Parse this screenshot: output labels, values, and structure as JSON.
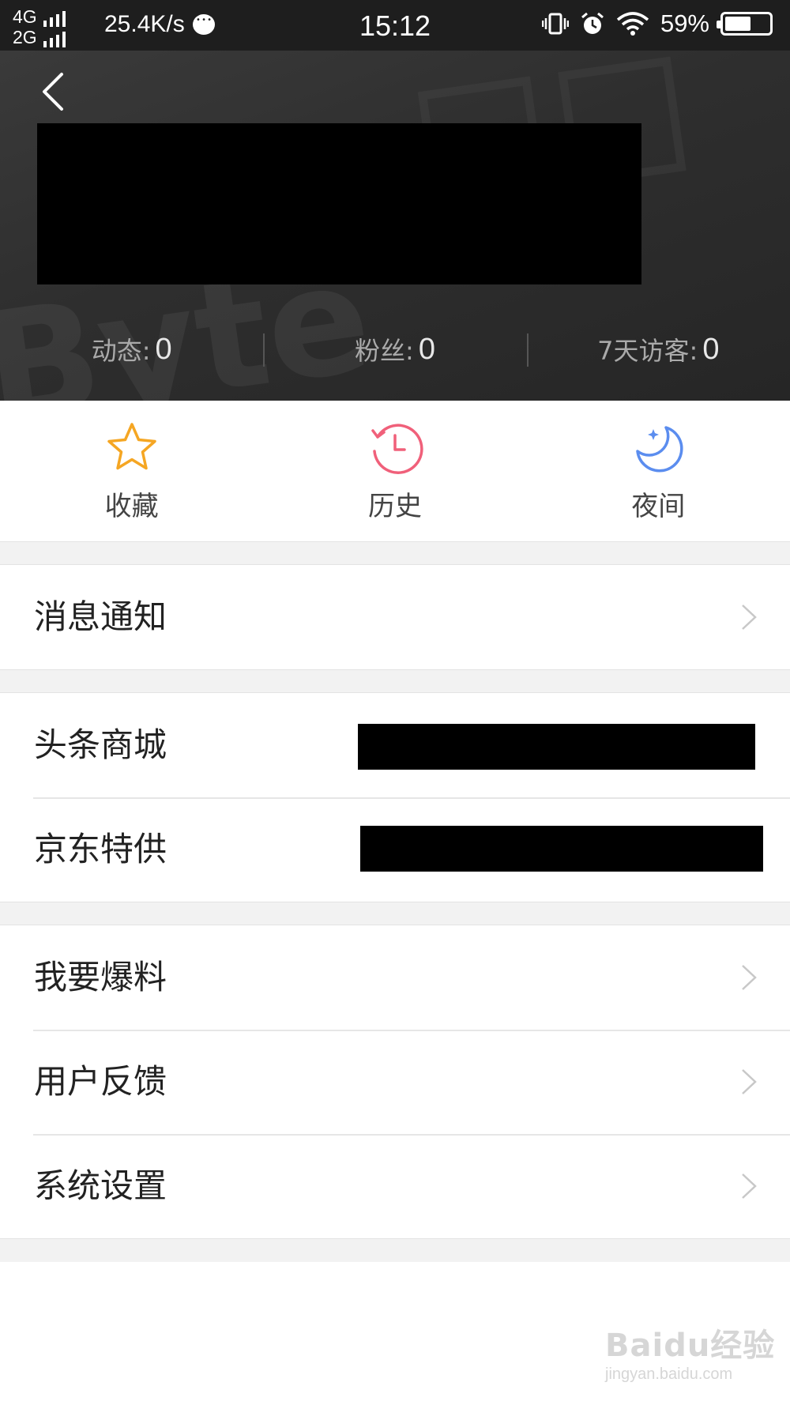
{
  "status_bar": {
    "network_1": "4G",
    "network_2": "2G",
    "speed": "25.4K/s",
    "time": "15:12",
    "battery": "59%",
    "battery_level": 0.59,
    "icons": [
      "signal-icon",
      "chat-icon",
      "vibrate-icon",
      "alarm-icon",
      "wifi-icon",
      "battery-icon"
    ]
  },
  "header": {
    "stats": [
      {
        "label": "动态:",
        "value": "0"
      },
      {
        "label": "粉丝:",
        "value": "0"
      },
      {
        "label": "7天访客:",
        "value": "0"
      }
    ]
  },
  "quick_actions": [
    {
      "label": "收藏",
      "icon": "star-icon",
      "color": "#f5a623"
    },
    {
      "label": "历史",
      "icon": "clock-history-icon",
      "color": "#f0607a"
    },
    {
      "label": "夜间",
      "icon": "moon-icon",
      "color": "#5b8def"
    }
  ],
  "menu": {
    "message": "消息通知",
    "mall": "头条商城",
    "jd": "京东特供",
    "report": "我要爆料",
    "feedback": "用户反馈",
    "settings": "系统设置"
  },
  "watermark": {
    "line1": "Baidu经验",
    "line2": "jingyan.baidu.com"
  }
}
